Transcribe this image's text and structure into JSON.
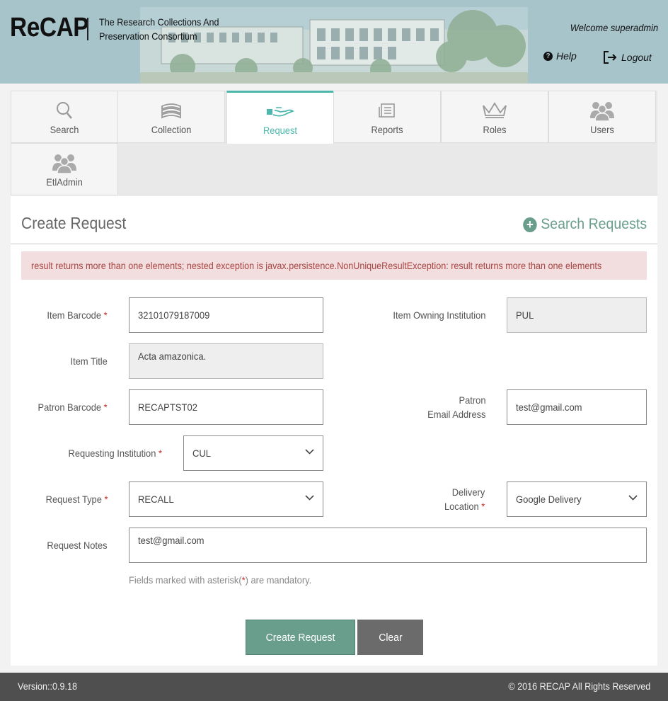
{
  "header": {
    "logo": "ReCAP",
    "tagline": "The Research Collections And Preservation Consortium",
    "welcome": "Welcome superadmin",
    "help": "Help",
    "logout": "Logout"
  },
  "nav": {
    "items": [
      {
        "label": "Search",
        "icon": "search-icon"
      },
      {
        "label": "Collection",
        "icon": "books-icon"
      },
      {
        "label": "Request",
        "icon": "hand-book-icon",
        "active": true
      },
      {
        "label": "Reports",
        "icon": "document-icon"
      },
      {
        "label": "Roles",
        "icon": "crown-icon"
      },
      {
        "label": "Users",
        "icon": "users-icon"
      },
      {
        "label": "EtlAdmin",
        "icon": "users-icon"
      }
    ]
  },
  "page": {
    "title": "Create Request",
    "search_requests": "Search Requests"
  },
  "alert": {
    "message": "result returns more than one elements; nested exception is javax.persistence.NonUniqueResultException: result returns more than one elements"
  },
  "form": {
    "item_barcode": {
      "label": "Item Barcode",
      "value": "32101079187009"
    },
    "item_owning_institution": {
      "label": "Item Owning Institution",
      "value": "PUL"
    },
    "item_title": {
      "label": "Item Title",
      "value": "Acta amazonica."
    },
    "patron_barcode": {
      "label": "Patron Barcode",
      "value": "RECAPTST02"
    },
    "patron_email": {
      "label_line1": "Patron",
      "label_line2": "Email Address",
      "value": "test@gmail.com"
    },
    "requesting_institution": {
      "label": "Requesting Institution",
      "value": "CUL"
    },
    "request_type": {
      "label": "Request Type",
      "value": "RECALL"
    },
    "delivery_location": {
      "label_line1": "Delivery",
      "label_line2": "Location",
      "value": "Google Delivery"
    },
    "request_notes": {
      "label": "Request Notes",
      "value": "test@gmail.com"
    },
    "required_marker": "*",
    "hint_before": "Fields marked with asterisk(",
    "hint_after": ") are mandatory."
  },
  "buttons": {
    "create": "Create Request",
    "clear": "Clear"
  },
  "footer": {
    "version": "Version::0.9.18",
    "copyright": "© 2016 RECAP All Rights Reserved"
  },
  "colors": {
    "header_bg": "#a7c4cb",
    "accent": "#4cb8ad",
    "primary_button": "#6a9e8c",
    "alert_bg": "#f2dede",
    "alert_text": "#a94442",
    "footer_bg": "#4f4f4f"
  }
}
